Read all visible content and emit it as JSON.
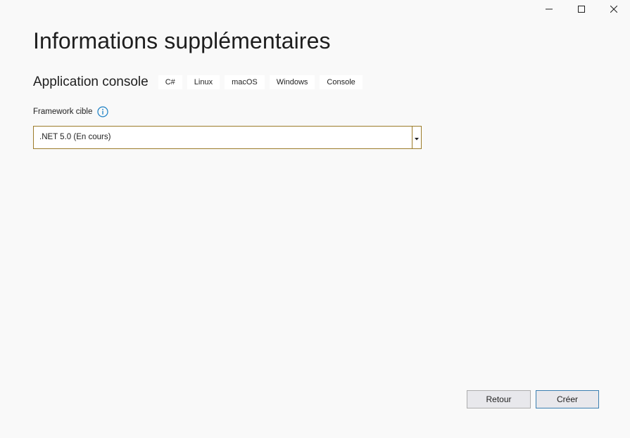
{
  "window_controls": {
    "minimize_icon": "minimize-icon",
    "maximize_icon": "maximize-icon",
    "close_icon": "close-icon"
  },
  "page": {
    "title": "Informations supplémentaires"
  },
  "template": {
    "name": "Application console",
    "tags": [
      "C#",
      "Linux",
      "macOS",
      "Windows",
      "Console"
    ]
  },
  "framework": {
    "label": "Framework cible",
    "info_icon": "info-icon",
    "selected_value": ".NET 5.0 (En cours)",
    "dropdown_icon": "chevron-down-icon"
  },
  "buttons": {
    "back_label": "Retour",
    "create_label": "Créer"
  },
  "colors": {
    "background": "#f9f9f9",
    "select_border": "#9c7c2a",
    "info_icon": "#1a7fc4",
    "primary_button_border": "#3c7fb1"
  }
}
